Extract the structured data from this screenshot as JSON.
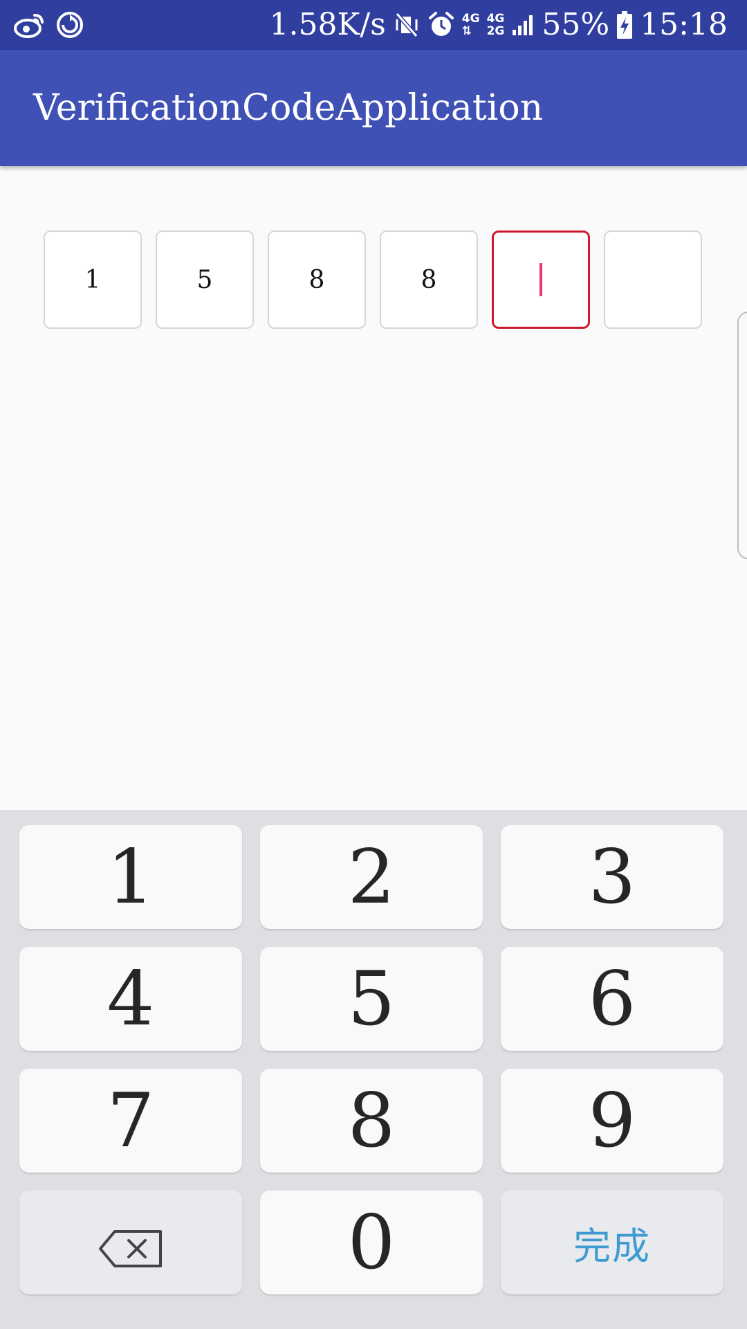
{
  "status_bar": {
    "net_speed": "1.58K/s",
    "net_primary": "4G",
    "net_secondary_top": "4G",
    "net_secondary_bottom": "2G",
    "battery": "55%",
    "time": "15:18"
  },
  "app_bar": {
    "title": "VerificationCodeApplication"
  },
  "code_input": {
    "digits": [
      "1",
      "5",
      "8",
      "8",
      "",
      ""
    ],
    "active_index": 4,
    "colors": {
      "active_border": "#cc1a2c",
      "cursor": "#e8387a"
    }
  },
  "keypad": {
    "keys": [
      "1",
      "2",
      "3",
      "4",
      "5",
      "6",
      "7",
      "8",
      "9",
      "",
      "0",
      "完成"
    ],
    "done_label": "完成",
    "done_color": "#3e9ad0"
  },
  "colors": {
    "status_bar": "#303f9f",
    "app_bar": "#3f51b5",
    "background": "#fafafa",
    "keypad_background": "#dfdfe3"
  }
}
